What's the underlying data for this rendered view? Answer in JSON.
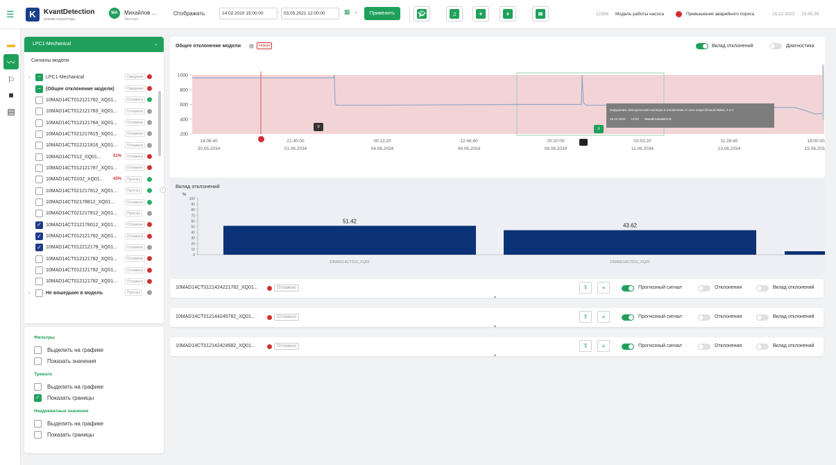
{
  "header": {
    "brand": "KvantDetection",
    "brand_sub": "режим оператора",
    "avatar": "МА",
    "user_name": "Михайлов ...",
    "user_role": "Эксперт",
    "display_label": "Отображать",
    "date_from": "14.02.2020  15:00:00",
    "date_to": "03.05.2021  12:00:00",
    "apply": "Применить",
    "alert_code": "12356",
    "alert_model": "Модель работы насоса",
    "alert_text": "Превышение аварийного порога",
    "alert_date": "15.12.2022",
    "alert_time": "10:45:26"
  },
  "model_select": "LPC1-Mechanical",
  "signals_title": "Сигналы модели",
  "tree": {
    "root": "LPC1-Mechanical",
    "root_tag": "Ожидание",
    "items": [
      {
        "label": "(Общее отклонение модели)",
        "tag": "Ожидание",
        "dot": "#d32f2f",
        "check": "green",
        "pct": ""
      },
      {
        "label": "10MAD14CT012121782_XQ01...",
        "tag": "Отлажено",
        "dot": "#27ae60",
        "check": "off",
        "pct": ""
      },
      {
        "label": "10MAD14CT012121783_XQ01...",
        "tag": "Отлажено",
        "dot": "#9e9e9e",
        "check": "off",
        "pct": ""
      },
      {
        "label": "10MAD14CT012121784_XQ01...",
        "tag": "Отлажено",
        "dot": "#9e9e9e",
        "check": "off",
        "pct": ""
      },
      {
        "label": "10MAD14CT021217815_XQ01...",
        "tag": "Отлажено",
        "dot": "#9e9e9e",
        "check": "off",
        "pct": ""
      },
      {
        "label": "10MAD14CT012121816_XQ01...",
        "tag": "Отлажено",
        "dot": "#9e9e9e",
        "check": "off",
        "pct": ""
      },
      {
        "label": "10MAD14CT012_XQ01...",
        "tag": "Отлажено",
        "dot": "#d32f2f",
        "check": "off",
        "pct": "51%"
      },
      {
        "label": "10MAD14CT012121787_XQ01...",
        "tag": "Отлажено",
        "dot": "#d32f2f",
        "check": "off",
        "pct": ""
      },
      {
        "label": "10MAD14CT0102_XQ01...",
        "tag": "Прогноз",
        "dot": "#27ae60",
        "check": "off",
        "pct": "43%"
      },
      {
        "label": "10MAD14CT021217812_XQ01...",
        "tag": "Прогноз",
        "dot": "#27ae60",
        "check": "off",
        "pct": ""
      },
      {
        "label": "10MAD14CT02178812_XQ01...",
        "tag": "Отлажено",
        "dot": "#27ae60",
        "check": "off",
        "pct": ""
      },
      {
        "label": "10MAD14CT021217812_XQ01...",
        "tag": "Прогноз",
        "dot": "#9e9e9e",
        "check": "off",
        "pct": ""
      },
      {
        "label": "10MAD14CT212178012_XQ01...",
        "tag": "Отлажено",
        "dot": "#d32f2f",
        "check": "on",
        "pct": ""
      },
      {
        "label": "10MAD14CT012121782_XQ01...",
        "tag": "Отлажено",
        "dot": "#d32f2f",
        "check": "on",
        "pct": ""
      },
      {
        "label": "10MAD14CT012212178_XQ01...",
        "tag": "Отлажено",
        "dot": "#9e9e9e",
        "check": "on",
        "pct": ""
      },
      {
        "label": "10MAD14CT012121782_XQ01...",
        "tag": "Отлажено",
        "dot": "#d32f2f",
        "check": "off",
        "pct": ""
      },
      {
        "label": "10MAD14CT012121782_XQ01...",
        "tag": "Отлажено",
        "dot": "#d32f2f",
        "check": "off",
        "pct": ""
      },
      {
        "label": "10MAD14CT012121782_XQ01...",
        "tag": "Отлажено",
        "dot": "#d32f2f",
        "check": "off",
        "pct": ""
      }
    ],
    "last": "Не вошедшие в модель",
    "last_tag": "Прогноз"
  },
  "filters": {
    "title1": "Фильтры",
    "f1a": "Выделить на графике",
    "f1b": "Показать значения",
    "title2": "Тревоги",
    "f2a": "Выделить на графике",
    "f2b": "Показать границы",
    "title3": "Неадекватные значения",
    "f3a": "Выделить на графике",
    "f3b": "Показать границы"
  },
  "main_chart": {
    "title": "Общее отклонение модели",
    "badge": "Новая",
    "toggle1": "Вклад отклонений",
    "toggle2": "Диагностика",
    "tooltip_text": "Нарушение электрической изоляции и отключение от сети энергоблоков №№1, 2 и 4",
    "tooltip_date": "15.12.2022",
    "tooltip_time": "12:00",
    "tooltip_user": "Михайловский В.В."
  },
  "chart_data": [
    {
      "type": "line",
      "title": "Общее отклонение модели",
      "y_ticks": [
        "1000",
        "800",
        "600",
        "400",
        "200"
      ],
      "ylim": [
        200,
        1000
      ],
      "x_ticks": [
        {
          "t": "14:06:40",
          "d": "30.05.2034"
        },
        {
          "t": "21:40:00",
          "d": "01.06.2034"
        },
        {
          "t": "05:13:20",
          "d": "04.06.2034"
        },
        {
          "t": "12:46:40",
          "d": "06.06.2034"
        },
        {
          "t": "20:20:00",
          "d": "08.06.2034"
        },
        {
          "t": "03:53:20",
          "d": "11.06.2034"
        },
        {
          "t": "11:26:40",
          "d": "13.06.2034"
        },
        {
          "t": "19:00:00",
          "d": "15.06.2034"
        }
      ],
      "grid": false
    },
    {
      "type": "bar",
      "title": "Вклад отклонений",
      "ylabel": "%",
      "ylim": [
        0,
        100
      ],
      "y_ticks": [
        "100",
        "90",
        "80",
        "70",
        "60",
        "50",
        "40",
        "30",
        "20",
        "10",
        "0"
      ],
      "categories": [
        "10MAD14CT012_XQ01",
        "10MAD14CT011_XQ01"
      ],
      "values": [
        51.42,
        43.62
      ],
      "value_labels": [
        "51.42",
        "43.62"
      ],
      "color": "#0b3276"
    }
  ],
  "signal_cards": [
    {
      "name": "10MAD14CT0121424221782_XQ01...",
      "status": "Отлажено"
    },
    {
      "name": "10MAD14CT012144245782_XQ01...",
      "status": "Отлажено"
    },
    {
      "name": "10MAD14CT012142424582_XQ01...",
      "status": "Отлажено"
    }
  ],
  "card_toggles": {
    "t1": "Прогнозный сигнал",
    "t2": "Отклонения",
    "t3": "Вклад отклонений"
  },
  "colors": {
    "accent": "#1fa05a",
    "bar": "#0b3276",
    "alarm": "#d32f2f",
    "band": "#f3d4d6"
  }
}
